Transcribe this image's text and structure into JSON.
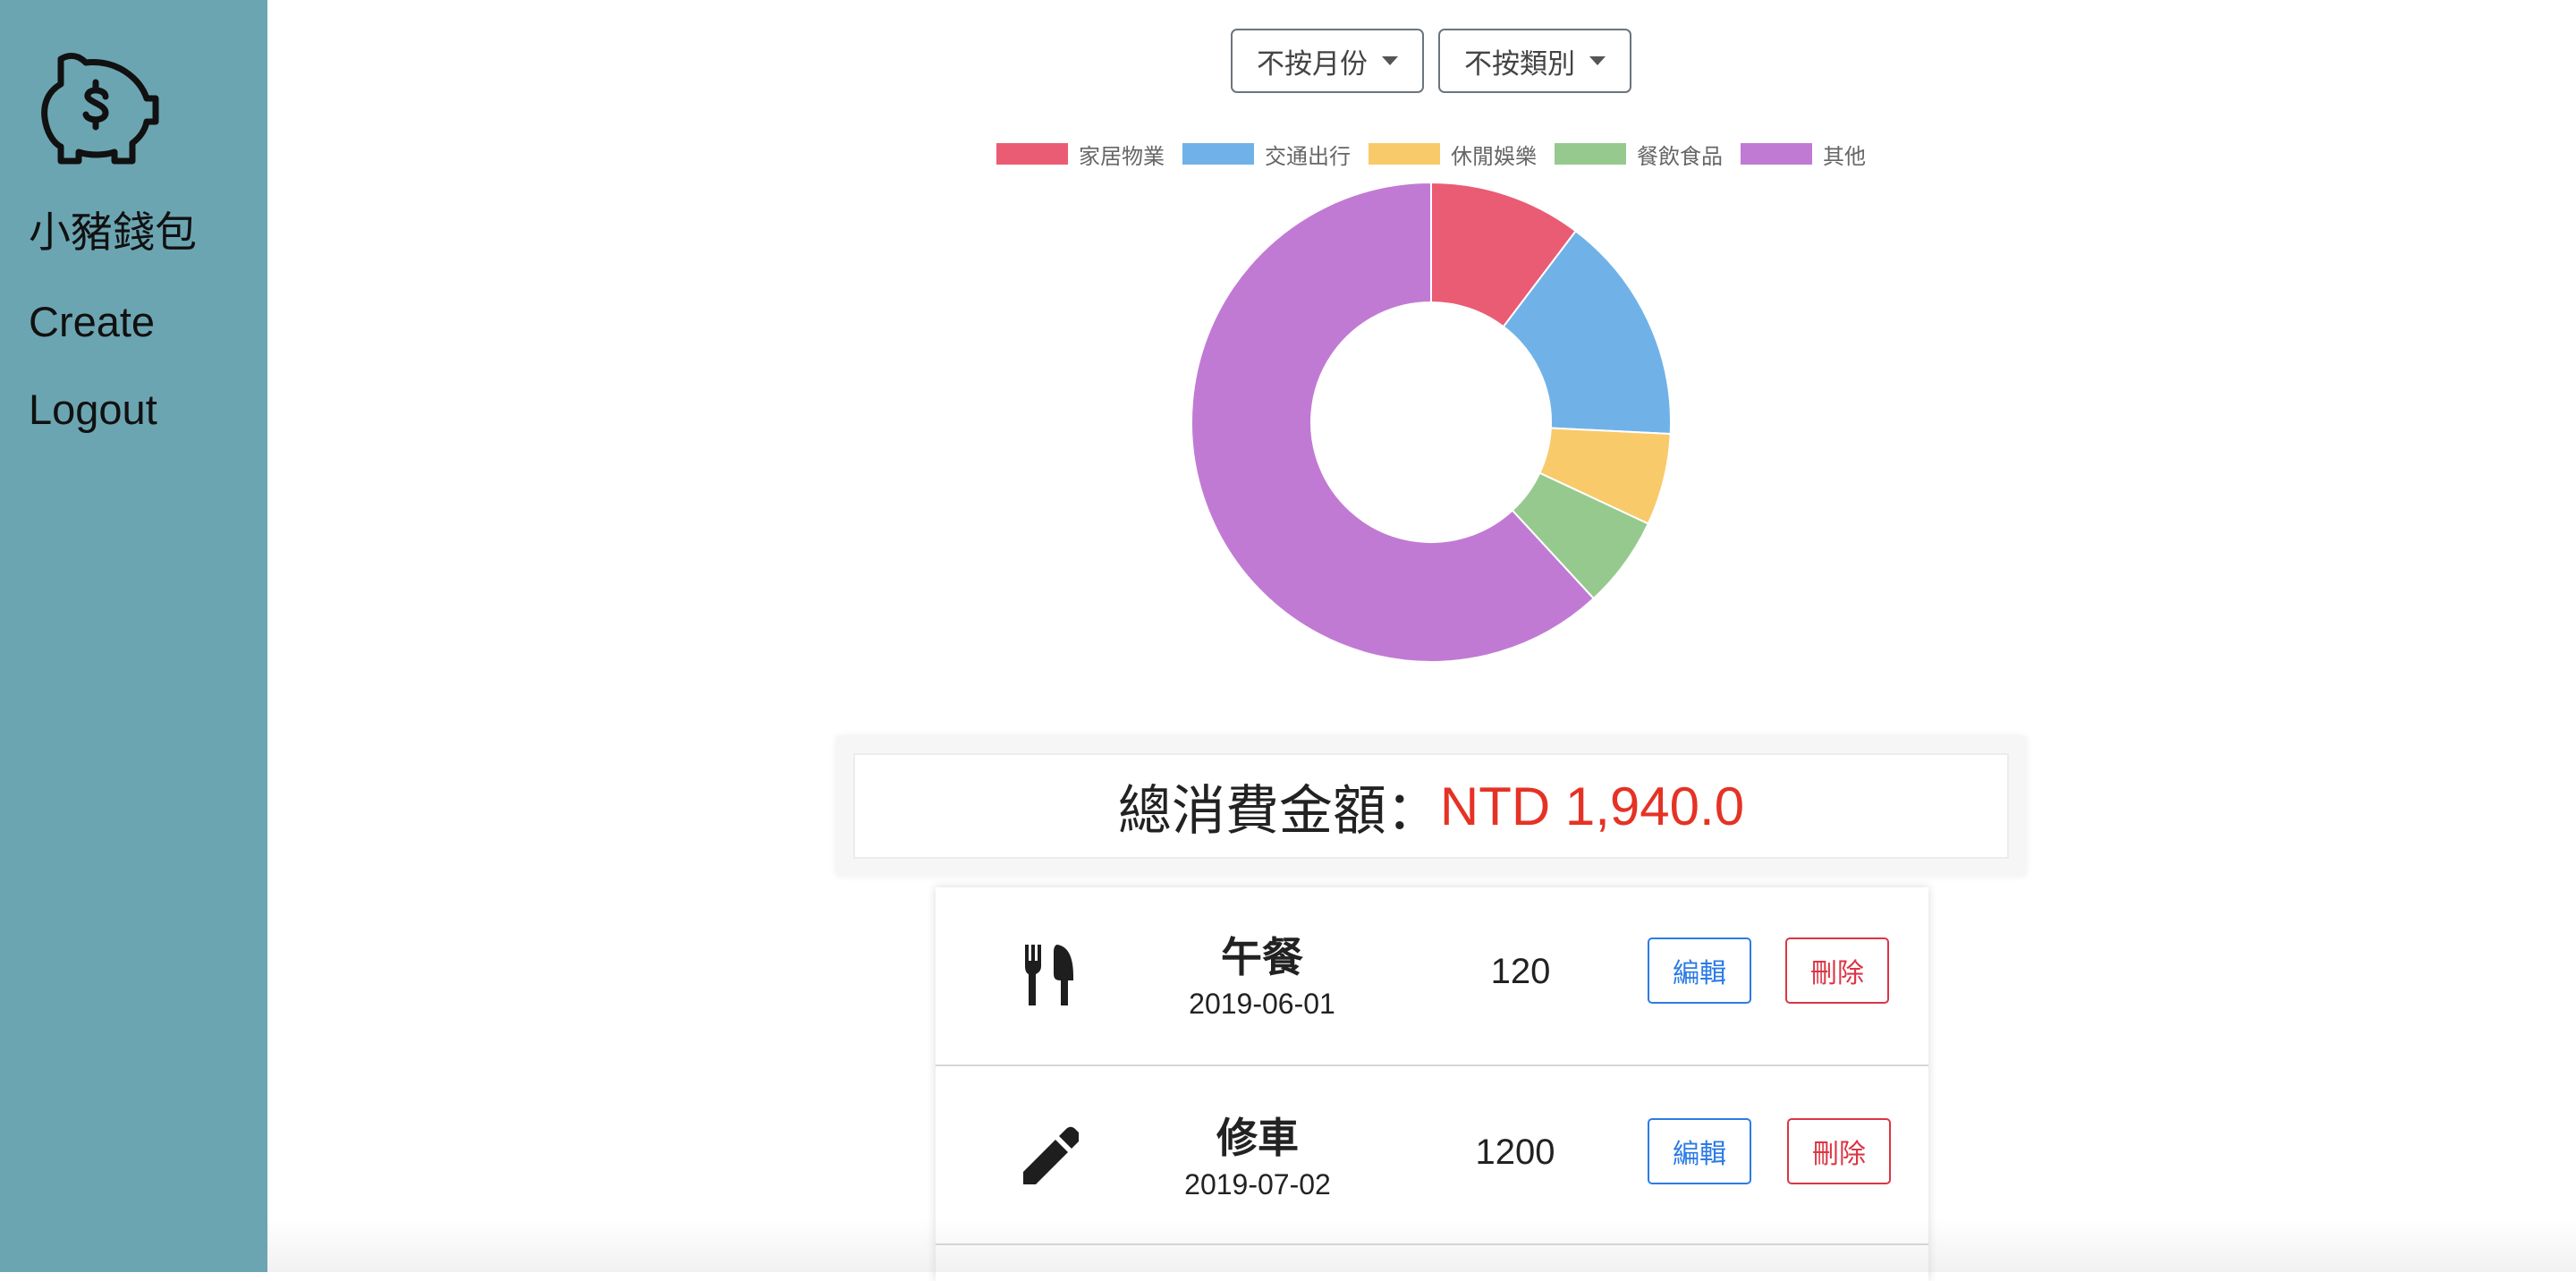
{
  "sidebar": {
    "logo": {
      "icon": "piggy-bank-dollar-icon"
    },
    "items": [
      {
        "label": "小豬錢包"
      },
      {
        "label": "Create"
      },
      {
        "label": "Logout"
      }
    ]
  },
  "filters": {
    "month": {
      "selected": "不按月份"
    },
    "category": {
      "selected": "不按類別"
    }
  },
  "chart_data": {
    "type": "pie",
    "variant": "doughnut",
    "legend_position": "top",
    "categories": [
      "家居物業",
      "交通出行",
      "休閒娛樂",
      "餐飲食品",
      "其他"
    ],
    "values": [
      200,
      300,
      120,
      120,
      1200
    ],
    "colors": [
      "#ea5c73",
      "#70b2e8",
      "#f8ca6a",
      "#96c98e",
      "#c17ad4"
    ]
  },
  "summary": {
    "label": "總消費金額：",
    "value": "NTD 1,940.0"
  },
  "records": [
    {
      "icon": "utensils-icon",
      "name": "午餐",
      "date": "2019-06-01",
      "amount": "120",
      "edit_label": "編輯",
      "delete_label": "刪除"
    },
    {
      "icon": "pencil-icon",
      "name": "修車",
      "date": "2019-07-02",
      "amount": "1200",
      "edit_label": "編輯",
      "delete_label": "刪除"
    }
  ]
}
